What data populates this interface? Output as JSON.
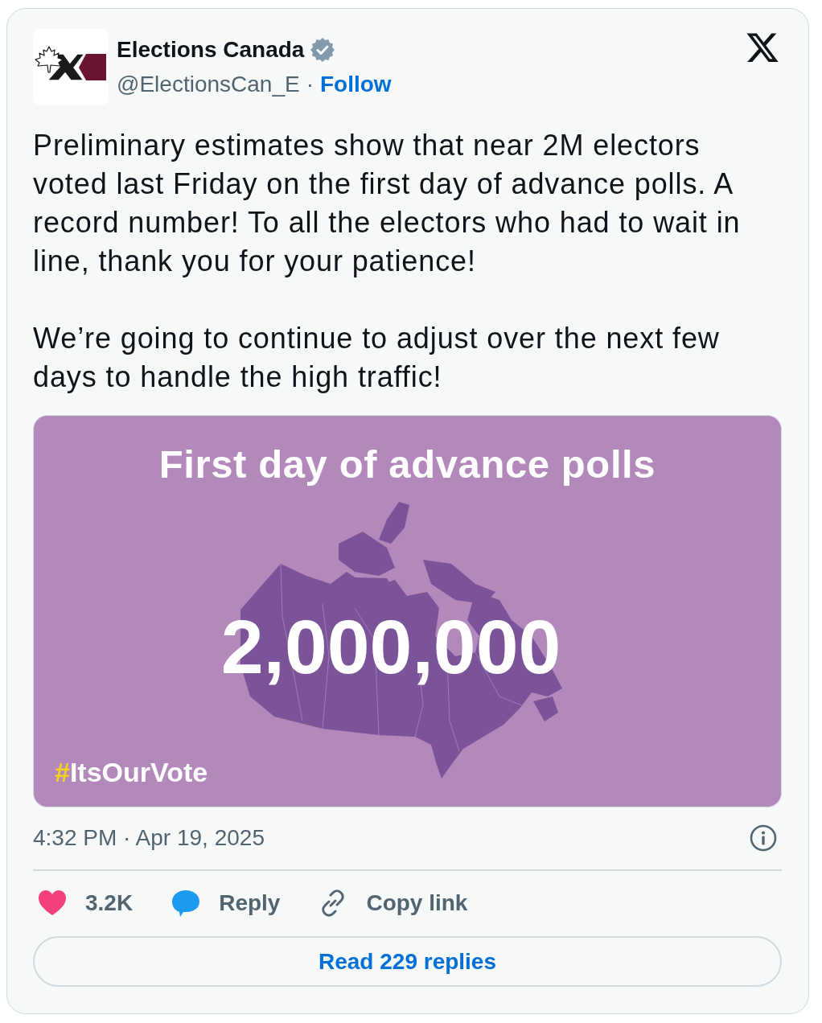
{
  "author": {
    "name": "Elections Canada",
    "verified": true,
    "handle": "@ElectionsCan_E",
    "separator": "·",
    "follow": "Follow"
  },
  "text": [
    "Preliminary estimates show that near 2M electors voted last Friday on the first day of advance polls. A record number! To all the electors who had to wait in line, thank you for your patience!",
    "We’re going to continue to adjust over the next few days to handle the high traffic!"
  ],
  "media": {
    "title": "First day of advance polls",
    "figure": "2,000,000",
    "hashtag": "#ItsOurVote"
  },
  "timestamp": "4:32 PM · Apr 19, 2025",
  "actions": [
    {
      "kind": "like",
      "label": "3.2K"
    },
    {
      "kind": "reply",
      "label": "Reply"
    },
    {
      "kind": "copy",
      "label": "Copy link"
    }
  ],
  "read_replies": "Read 229 replies"
}
